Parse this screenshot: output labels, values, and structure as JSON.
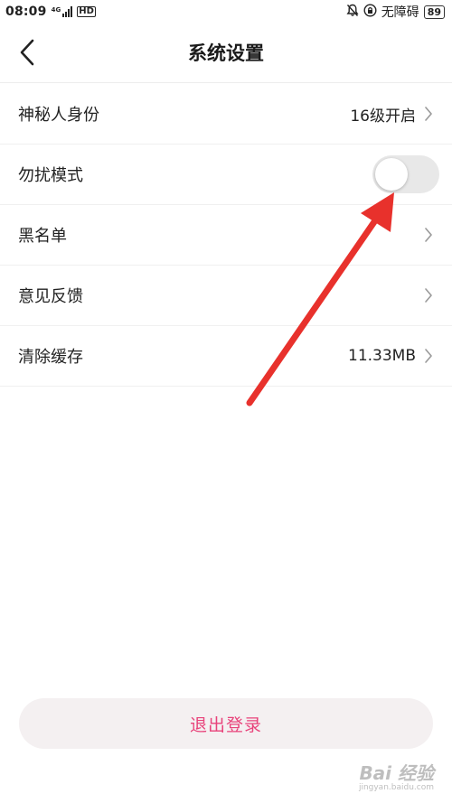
{
  "status_bar": {
    "time": "08:09",
    "network": "4G",
    "hd": "HD",
    "status_text": "无障碍",
    "battery": "89"
  },
  "header": {
    "title": "系统设置"
  },
  "settings": [
    {
      "label": "神秘人身份",
      "value": "16级开启",
      "type": "link"
    },
    {
      "label": "勿扰模式",
      "type": "toggle",
      "on": false
    },
    {
      "label": "黑名单",
      "type": "link"
    },
    {
      "label": "意见反馈",
      "type": "link"
    },
    {
      "label": "清除缓存",
      "value": "11.33MB",
      "type": "link"
    }
  ],
  "logout": {
    "label": "退出登录"
  },
  "watermark": {
    "main": "Bai 经验",
    "sub": "jingyan.baidu.com"
  },
  "colors": {
    "accent": "#e8437b",
    "annotation_arrow": "#e8312c",
    "toggle_off": "#e8e8e8"
  },
  "icons": [
    "back-arrow-icon",
    "chevron-right-icon",
    "bell-off-icon",
    "lock-rotation-icon",
    "signal-icon"
  ]
}
